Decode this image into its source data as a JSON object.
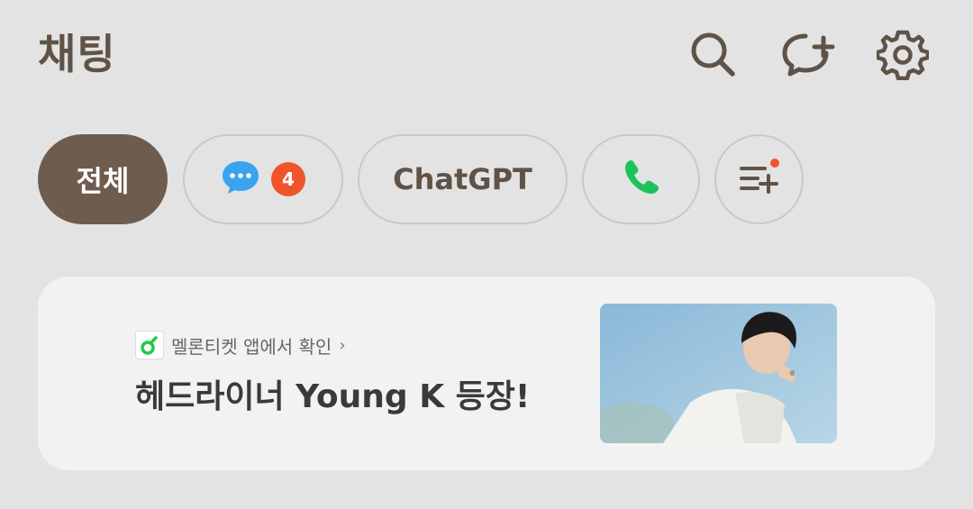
{
  "header": {
    "title": "채팅",
    "icons": [
      "search-icon",
      "new-chat-icon",
      "settings-icon"
    ]
  },
  "filters": [
    {
      "label": "전체",
      "selected": true
    },
    {
      "icon": "chat-bubble-icon",
      "badge": "4"
    },
    {
      "label": "ChatGPT"
    },
    {
      "icon": "phone-icon"
    },
    {
      "icon": "list-add-icon"
    }
  ],
  "ad": {
    "source": "멜론티켓 앱에서 확인",
    "chevron": "›",
    "headline": "헤드라이너 Young K 등장!"
  },
  "colors": {
    "background": "#e3e3e3",
    "accent_brown": "#6e5c4f",
    "badge_orange": "#f0542a",
    "phone_green": "#1ec25b",
    "chat_blue": "#3aa3f0",
    "melon_green": "#21c94d"
  }
}
